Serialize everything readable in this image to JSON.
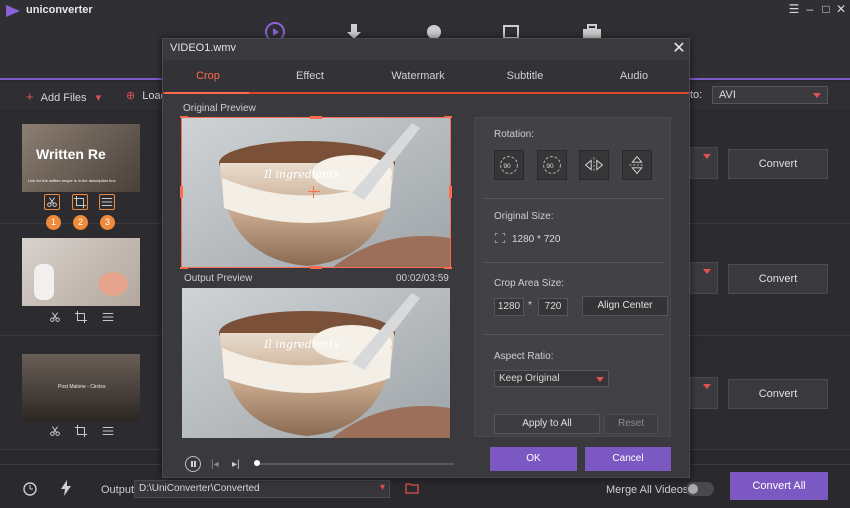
{
  "app": {
    "name": "uniconverter"
  },
  "toolbar": {
    "add_files": "Add Files",
    "load": "Load",
    "to_label": "to:",
    "format": "AVI"
  },
  "rows": [
    {
      "thumb_title": "Written Re",
      "thumb_sub": "Link for the written recipe is in the description box",
      "convert": "Convert",
      "badges": [
        "1",
        "2",
        "3"
      ]
    },
    {
      "convert": "Convert"
    },
    {
      "thumb_text": "Post Malone - Circles",
      "convert": "Convert"
    }
  ],
  "dialog": {
    "title": "VIDEO1.wmv",
    "tabs": [
      "Crop",
      "Effect",
      "Watermark",
      "Subtitle",
      "Audio"
    ],
    "active_tab": "Crop",
    "original_preview": "Original Preview",
    "output_preview": "Output Preview",
    "time": "00:02/03:59",
    "video_overlay_text": "Il ingredients",
    "rotation_label": "Rotation:",
    "rotate_left_text": "90",
    "rotate_right_text": "90",
    "original_size_label": "Original Size:",
    "original_size_value": "1280 * 720",
    "crop_area_label": "Crop Area Size:",
    "crop_width": "1280",
    "crop_times": "*",
    "crop_height": "720",
    "align_center": "Align Center",
    "aspect_label": "Aspect Ratio:",
    "aspect_value": "Keep Original",
    "apply_all": "Apply to All",
    "reset": "Reset",
    "ok": "OK",
    "cancel": "Cancel"
  },
  "bottom": {
    "output_label": "Output",
    "output_path": "D:\\UniConverter\\Converted",
    "merge_label": "Merge All Videos",
    "convert_all": "Convert All"
  },
  "colors": {
    "accent": "#7c58c2",
    "tab_active": "#ff6a4d",
    "badge": "#f08a3a"
  }
}
